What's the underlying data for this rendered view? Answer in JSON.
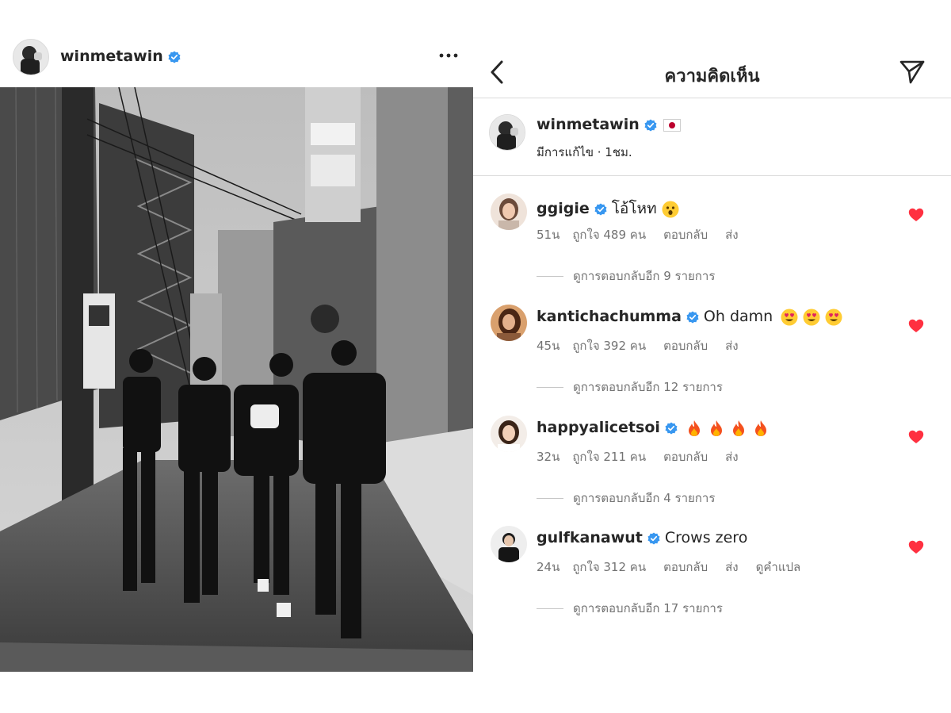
{
  "post": {
    "username": "winmetawin",
    "more_label": "•••"
  },
  "comments_panel": {
    "title": "ความคิดเห็น",
    "caption": {
      "username": "winmetawin",
      "flag": "japan-flag",
      "meta": "มีการแก้ไข · 1ชม."
    },
    "comments": [
      {
        "username": "ggigie",
        "text": "โอ้โหท",
        "emojis": [
          "astonished-face"
        ],
        "time": "51น",
        "likes": "ถูกใจ 489 คน",
        "reply": "ตอบกลับ",
        "send": "ส่ง",
        "translate": "",
        "view_replies": "ดูการตอบกลับอีก 9 รายการ"
      },
      {
        "username": "kantichachumma",
        "text": "Oh damn",
        "emojis": [
          "heart-eyes",
          "heart-eyes",
          "heart-eyes"
        ],
        "time": "45น",
        "likes": "ถูกใจ 392 คน",
        "reply": "ตอบกลับ",
        "send": "ส่ง",
        "translate": "",
        "view_replies": "ดูการตอบกลับอีก 12 รายการ"
      },
      {
        "username": "happyalicetsoi",
        "text": "",
        "emojis": [
          "fire",
          "fire",
          "fire",
          "fire"
        ],
        "time": "32น",
        "likes": "ถูกใจ 211 คน",
        "reply": "ตอบกลับ",
        "send": "ส่ง",
        "translate": "",
        "view_replies": "ดูการตอบกลับอีก 4 รายการ"
      },
      {
        "username": "gulfkanawut",
        "text": "Crows zero",
        "emojis": [],
        "time": "24น",
        "likes": "ถูกใจ 312 คน",
        "reply": "ตอบกลับ",
        "send": "ส่ง",
        "translate": "ดูคำแปล",
        "view_replies": "ดูการตอบกลับอีก 17 รายการ"
      }
    ]
  },
  "colors": {
    "verified": "#3897f0",
    "heart": "#ff3040",
    "text": "#262626",
    "muted": "#737373",
    "divider": "#dbdbdb"
  }
}
